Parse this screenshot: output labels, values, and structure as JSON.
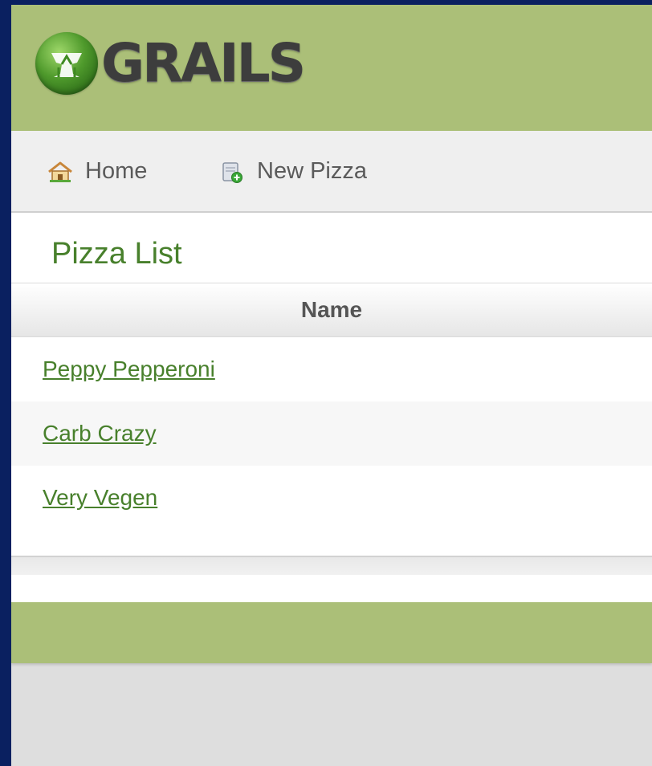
{
  "app": {
    "logo_text": "GRAILS",
    "brand_color": "#abbf78",
    "link_color": "#48802c"
  },
  "nav": {
    "home": {
      "label": "Home",
      "icon": "house-icon"
    },
    "new_pizza": {
      "label": "New Pizza",
      "icon": "database-add-icon"
    }
  },
  "page": {
    "title": "Pizza List"
  },
  "table": {
    "columns": [
      "Name"
    ],
    "rows": [
      {
        "name": "Peppy Pepperoni"
      },
      {
        "name": "Carb Crazy"
      },
      {
        "name": "Very Vegen"
      }
    ]
  }
}
